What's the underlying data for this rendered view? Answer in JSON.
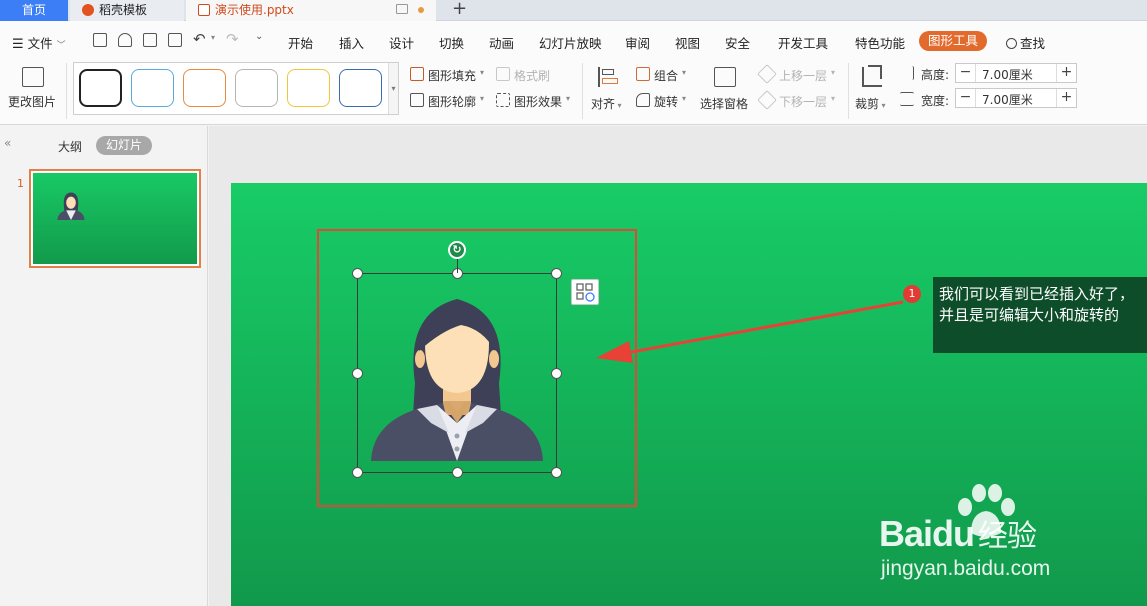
{
  "tabs": {
    "home": "首页",
    "daoke": "稻壳模板",
    "file": "演示使用.pptx"
  },
  "menubar": {
    "file": "文件",
    "items": [
      "开始",
      "插入",
      "设计",
      "切换",
      "动画",
      "幻灯片放映",
      "审阅",
      "视图",
      "安全",
      "开发工具",
      "特色功能"
    ],
    "active_tool": "图形工具",
    "search": "查找"
  },
  "ribbon": {
    "change_picture": "更改图片",
    "shape_fill": "图形填充",
    "shape_outline": "图形轮廓",
    "format_brush": "格式刷",
    "shape_effects": "图形效果",
    "align": "对齐",
    "group": "组合",
    "rotate": "旋转",
    "selection_pane": "选择窗格",
    "bring_forward": "上移一层",
    "send_backward": "下移一层",
    "crop": "裁剪",
    "height_label": "高度:",
    "width_label": "宽度:",
    "height_value": "7.00厘米",
    "width_value": "7.00厘米",
    "swatch_colors": [
      "#222222",
      "#5aa9dd",
      "#e98a3f",
      "#b5b5b5",
      "#f2c53d",
      "#3a6cb3"
    ]
  },
  "left_panel": {
    "outline_tab": "大纲",
    "slides_tab": "幻灯片",
    "slide_number": "1"
  },
  "slide": {
    "callout_number": "1",
    "callout_text": "我们可以看到已经插入好了，并且是可编辑大小和旋转的",
    "watermark": {
      "brand": "Baidu",
      "suffix": "经验",
      "url": "jingyan.baidu.com"
    }
  }
}
